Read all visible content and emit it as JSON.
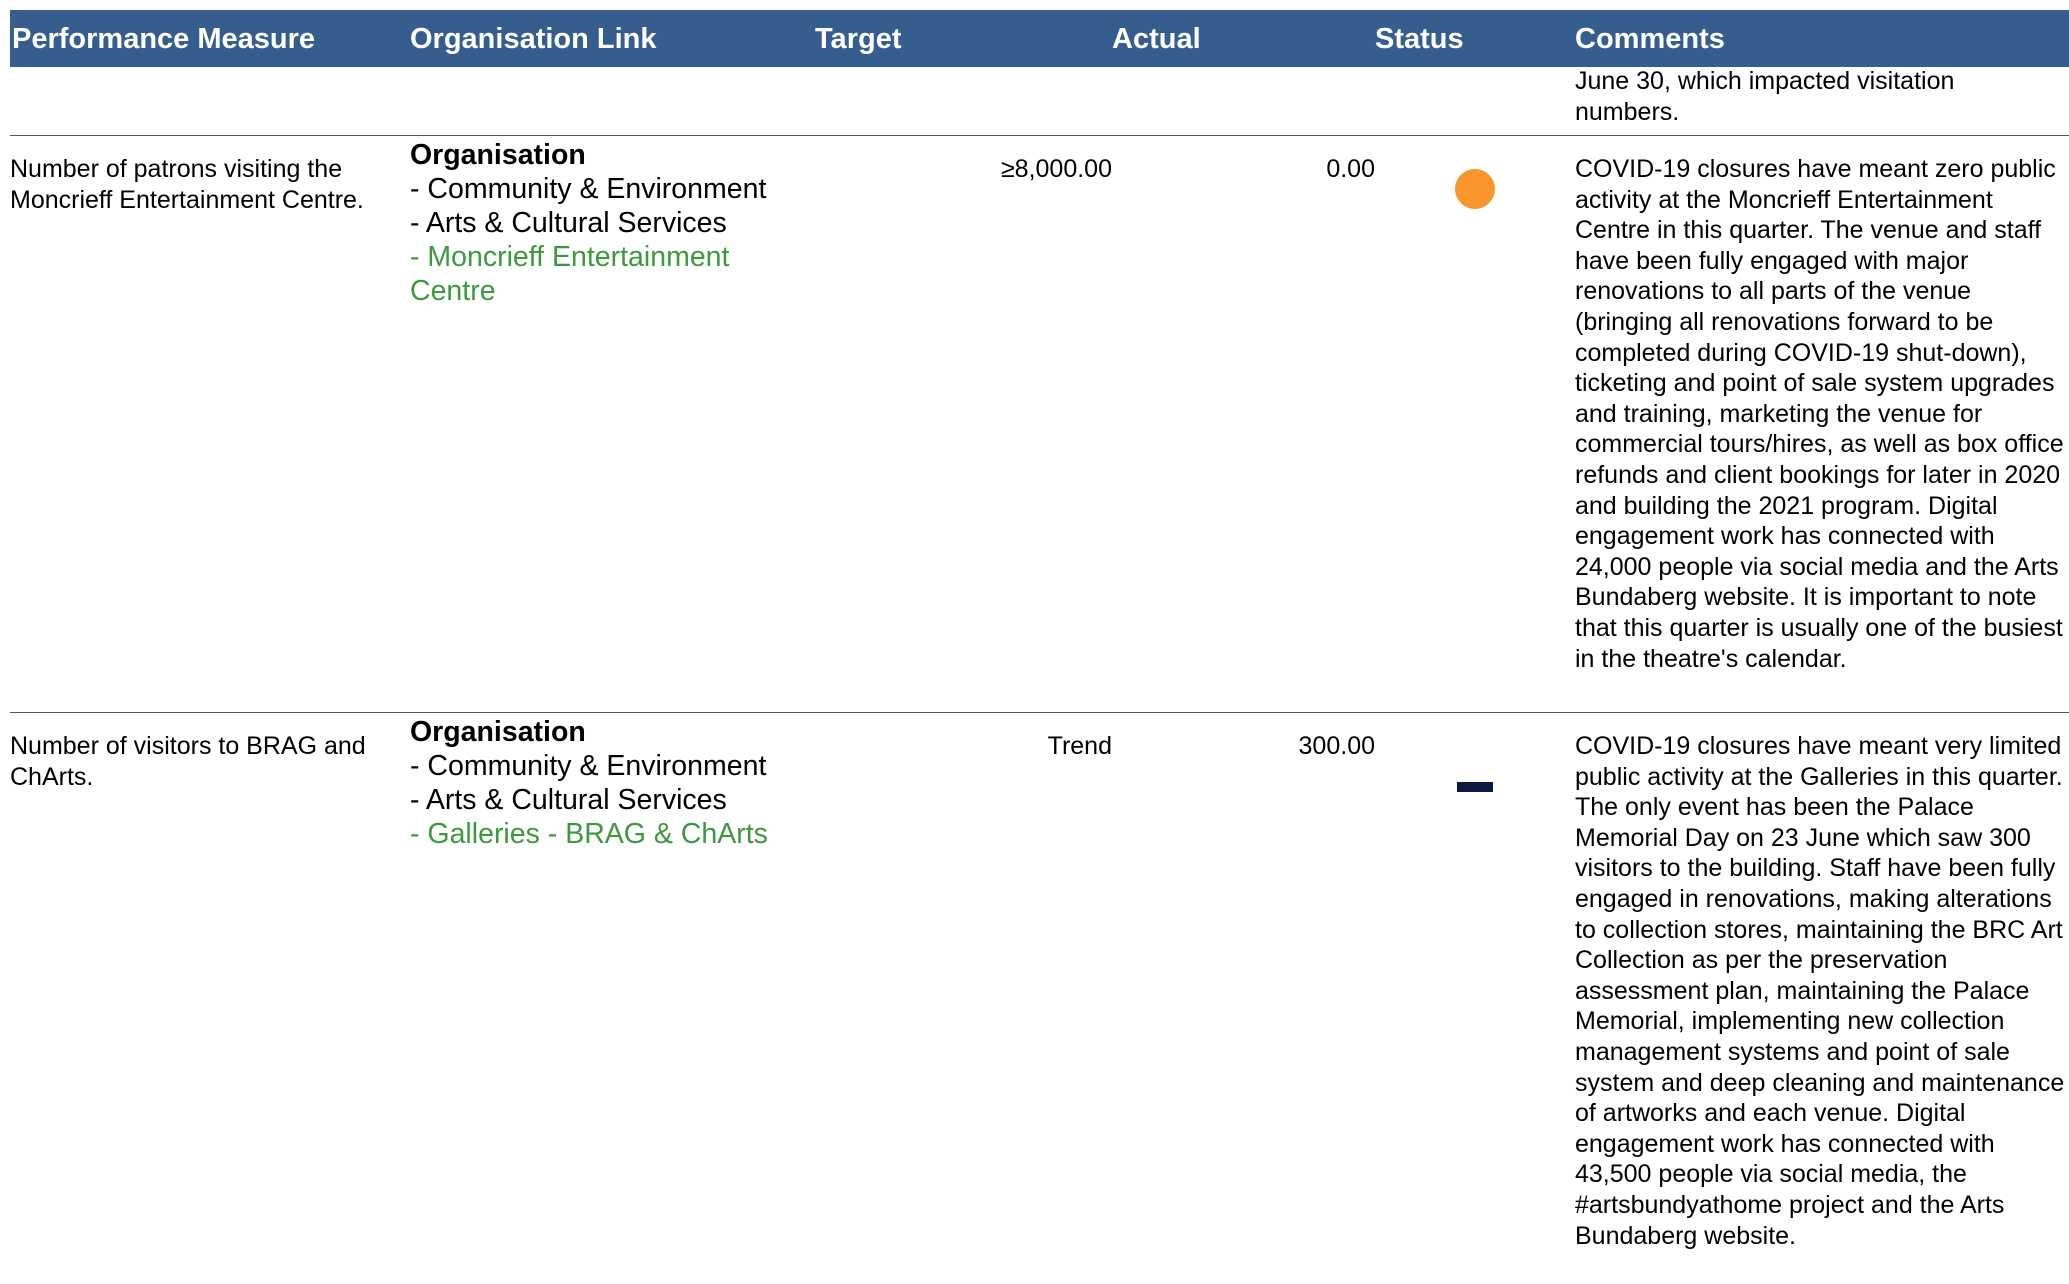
{
  "colors": {
    "header_bg": "#355e8f",
    "header_text": "#ffffff",
    "org_unit_text": "#3c9a3c",
    "status_orange": "#f7962b",
    "status_navy": "#0f1940"
  },
  "header": {
    "performance_measure": "Performance Measure",
    "organisation_link": "Organisation Link",
    "target": "Target",
    "actual": "Actual",
    "status": "Status",
    "comments": "Comments"
  },
  "previous_comment_tail": "June 30, which impacted visitation numbers.",
  "rows": [
    {
      "measure": "Number of patrons visiting the Moncrieff Entertainment Centre.",
      "org_title": "Organisation",
      "org_directorate": "- Community & Environment",
      "org_branch": "- Arts & Cultural Services",
      "org_unit": "- Moncrieff Entertainment Centre",
      "target": "≥8,000.00",
      "actual": "0.00",
      "status_icon": "orange-circle-icon",
      "comment": "COVID-19 closures have meant zero public activity at the Moncrieff Entertainment Centre in this quarter. The venue and staff have been fully engaged with major renovations to all parts of the venue (bringing all renovations forward to be completed during COVID-19 shut-down), ticketing and point of sale system upgrades and training, marketing the venue for commercial tours/hires, as well as box office refunds and client bookings for later in 2020 and building the 2021 program. Digital engagement work has connected with 24,000 people via social media and the Arts Bundaberg website. It is important to note that this quarter is usually one of the busiest in the theatre's calendar."
    },
    {
      "measure": "Number of visitors to BRAG and ChArts.",
      "org_title": "Organisation",
      "org_directorate": "- Community & Environment",
      "org_branch": "- Arts & Cultural Services",
      "org_unit": "- Galleries - BRAG & ChArts",
      "target": "Trend",
      "actual": "300.00",
      "status_icon": "dash-icon",
      "comment": "COVID-19 closures have meant very limited public activity at the Galleries in this quarter. The only event has been the Palace Memorial Day on 23 June which saw 300 visitors to the building. Staff have been fully engaged in renovations, making alterations to collection stores, maintaining the BRC Art Collection as per the preservation assessment plan, maintaining the Palace Memorial, implementing new collection management systems and point of sale system and deep cleaning and maintenance of artworks and each venue. Digital engagement work has connected with 43,500 people via social media, the #artsbundyathome project and the Arts Bundaberg website."
    }
  ]
}
